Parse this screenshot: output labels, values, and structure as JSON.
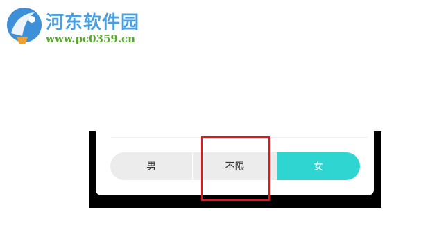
{
  "watermark": {
    "title": "河东软件园",
    "url": "www.pc0359.cn",
    "logo_icon": "watermark-logo-icon"
  },
  "gender_selector": {
    "options": [
      {
        "label": "男",
        "selected": false
      },
      {
        "label": "不限",
        "selected": false
      },
      {
        "label": "女",
        "selected": true
      }
    ]
  },
  "colors": {
    "selected_bg": "#2ed5d1",
    "unselected_bg": "#ececec",
    "highlight_border": "#e8141c",
    "watermark_title": "#4a9fe0",
    "watermark_url": "#5aa832"
  }
}
